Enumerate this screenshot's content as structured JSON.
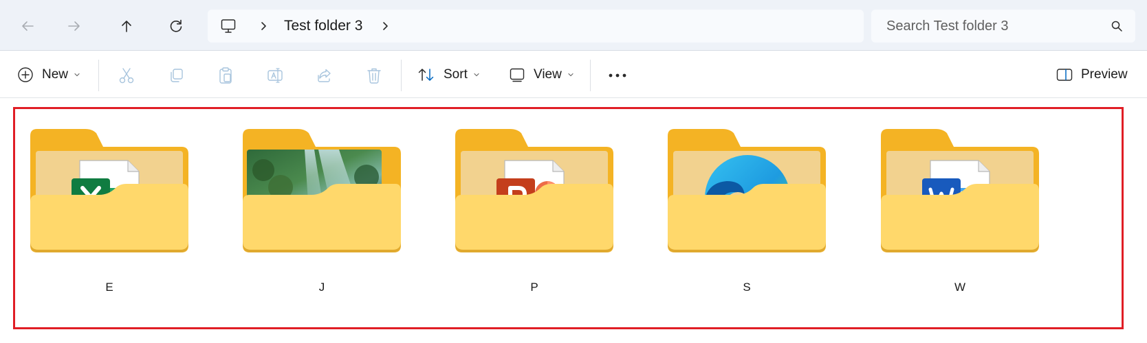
{
  "address_bar": {
    "breadcrumb": "Test folder 3",
    "search_placeholder": "Search Test folder 3"
  },
  "command_bar": {
    "new_label": "New",
    "sort_label": "Sort",
    "view_label": "View",
    "preview_label": "Preview"
  },
  "folders": [
    {
      "name": "E",
      "thumbnail": "excel-file-icon"
    },
    {
      "name": "J",
      "thumbnail": "forest-photo"
    },
    {
      "name": "P",
      "thumbnail": "powerpoint-file-icon"
    },
    {
      "name": "S",
      "thumbnail": "edge-browser-icon"
    },
    {
      "name": "W",
      "thumbnail": "word-file-icon"
    }
  ],
  "colors": {
    "folder_back": "#F4B324",
    "folder_front": "#FFD86B",
    "selection_border": "#E01E25",
    "accent": "#0067C0"
  }
}
